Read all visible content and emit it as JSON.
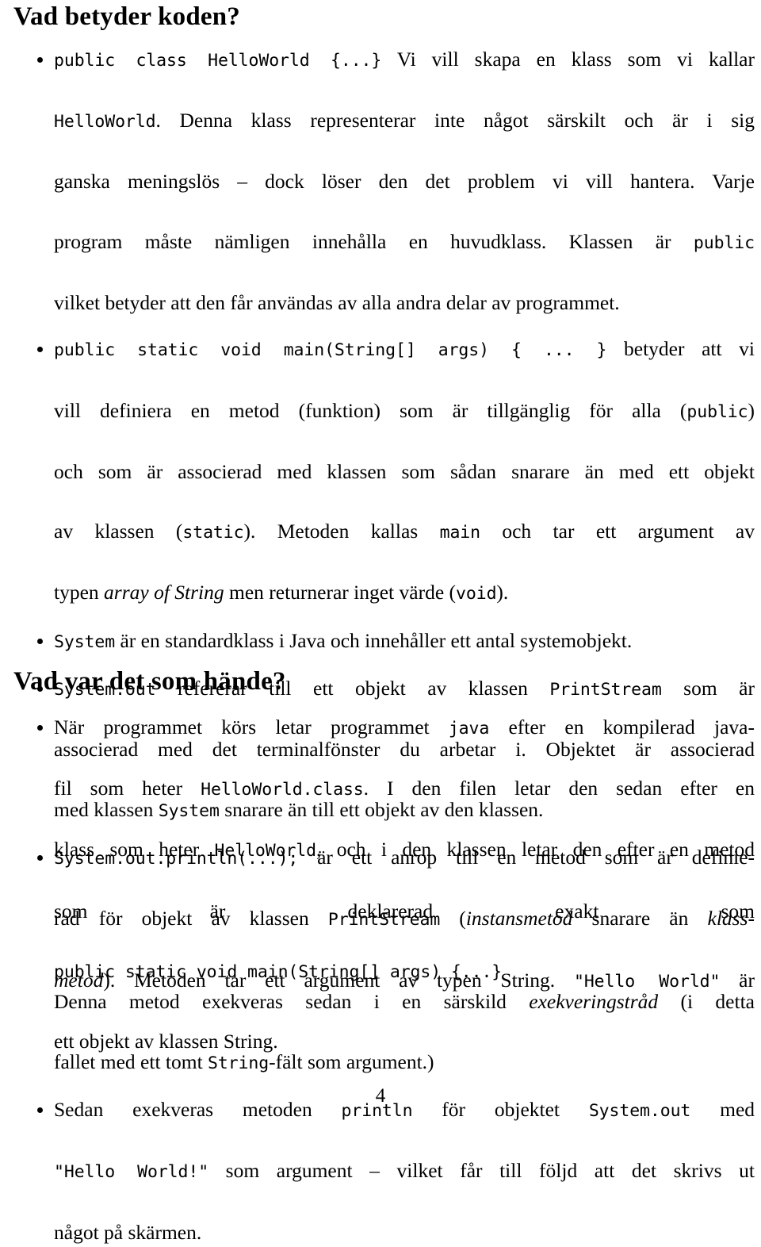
{
  "document": {
    "language": "sv",
    "page_number": "4",
    "background_color": "#ffffff",
    "text_color": "#000000"
  },
  "sections": [
    {
      "heading": "Vad betyder koden?",
      "bullets": [
        {
          "id": "bullet-public-class",
          "lines": [
            [
              {
                "t": "code",
                "v": "public class HelloWorld {...}"
              },
              {
                "t": "text",
                "v": " Vi vill skapa en klass som vi kallar"
              }
            ],
            [
              {
                "t": "code",
                "v": "HelloWorld"
              },
              {
                "t": "text",
                "v": ". Denna klass representerar inte något särskilt och är i sig"
              }
            ],
            [
              {
                "t": "text",
                "v": "ganska meningslös – dock löser den det problem vi vill hantera. Varje"
              }
            ],
            [
              {
                "t": "text",
                "v": "program måste nämligen innehålla en huvudklass. Klassen är "
              },
              {
                "t": "code",
                "v": "public"
              }
            ],
            [
              {
                "t": "text",
                "v": "vilket betyder att den får användas av alla andra delar av programmet."
              }
            ]
          ]
        },
        {
          "id": "bullet-main-method",
          "lines": [
            [
              {
                "t": "code",
                "v": "public static void main(String[] args) { ... }"
              },
              {
                "t": "text",
                "v": " betyder att vi"
              }
            ],
            [
              {
                "t": "text",
                "v": "vill definiera en metod (funktion) som är tillgänglig för alla ("
              },
              {
                "t": "code",
                "v": "public"
              },
              {
                "t": "text",
                "v": ")"
              }
            ],
            [
              {
                "t": "text",
                "v": "och som är associerad med klassen som sådan snarare än med ett objekt"
              }
            ],
            [
              {
                "t": "text",
                "v": "av klassen ("
              },
              {
                "t": "code",
                "v": "static"
              },
              {
                "t": "text",
                "v": "). Metoden kallas "
              },
              {
                "t": "code",
                "v": "main"
              },
              {
                "t": "text",
                "v": " och tar ett argument av"
              }
            ],
            [
              {
                "t": "text",
                "v": "typen "
              },
              {
                "t": "italic",
                "v": "array of String"
              },
              {
                "t": "text",
                "v": " men returnerar inget värde ("
              },
              {
                "t": "code",
                "v": "void"
              },
              {
                "t": "text",
                "v": ")."
              }
            ]
          ]
        },
        {
          "id": "bullet-system",
          "lines": [
            [
              {
                "t": "code",
                "v": "System"
              },
              {
                "t": "text",
                "v": " är en standardklass i Java och innehåller ett antal systemobjekt."
              }
            ]
          ]
        },
        {
          "id": "bullet-system-out",
          "lines": [
            [
              {
                "t": "code",
                "v": "System.out"
              },
              {
                "t": "text",
                "v": " refererar till ett objekt av klassen "
              },
              {
                "t": "code",
                "v": "PrintStream"
              },
              {
                "t": "text",
                "v": " som är"
              }
            ],
            [
              {
                "t": "text",
                "v": "associerad med det terminalfönster du arbetar i. Objektet är associerad"
              }
            ],
            [
              {
                "t": "text",
                "v": "med klassen "
              },
              {
                "t": "code",
                "v": "System"
              },
              {
                "t": "text",
                "v": " snarare än till ett objekt av den klassen."
              }
            ]
          ]
        },
        {
          "id": "bullet-println",
          "lines": [
            [
              {
                "t": "code",
                "v": "System.out.println(...);"
              },
              {
                "t": "text",
                "v": " är ett anrop till en metod som är definie-"
              }
            ],
            [
              {
                "t": "text",
                "v": "rad för objekt av klassen "
              },
              {
                "t": "code",
                "v": "PrintStream"
              },
              {
                "t": "text",
                "v": " ("
              },
              {
                "t": "italic",
                "v": "instansmetod"
              },
              {
                "t": "text",
                "v": " snarare än "
              },
              {
                "t": "italic",
                "v": "klass-"
              }
            ],
            [
              {
                "t": "italic",
                "v": "metod"
              },
              {
                "t": "text",
                "v": "). Metoden tar ett argument av typen String. "
              },
              {
                "t": "code",
                "v": "\"Hello World\""
              },
              {
                "t": "text",
                "v": " är"
              }
            ],
            [
              {
                "t": "text",
                "v": "ett objekt av klassen String."
              }
            ]
          ]
        }
      ]
    },
    {
      "heading": "Vad var det som hände?",
      "bullets": [
        {
          "id": "bullet-java-runtime",
          "lines": [
            [
              {
                "t": "text",
                "v": "När programmet körs letar programmet "
              },
              {
                "t": "code",
                "v": "java"
              },
              {
                "t": "text",
                "v": " efter en kompilerad java-"
              }
            ],
            [
              {
                "t": "text",
                "v": "fil som heter "
              },
              {
                "t": "code",
                "v": "HelloWorld.class"
              },
              {
                "t": "text",
                "v": ". I den filen letar den sedan efter en"
              }
            ],
            [
              {
                "t": "text",
                "v": "klass som heter "
              },
              {
                "t": "code",
                "v": "HelloWorld"
              },
              {
                "t": "text",
                "v": ", och i den klassen letar den efter en metod"
              }
            ],
            [
              {
                "t": "text",
                "v": "som är deklarerad exakt som"
              }
            ],
            [
              {
                "t": "code",
                "v": "public static void main(String[] args) {...}"
              }
            ],
            [
              {
                "t": "text",
                "v": "Denna metod exekveras sedan i en särskild "
              },
              {
                "t": "italic",
                "v": "exekveringstråd"
              },
              {
                "t": "text",
                "v": " (i detta"
              }
            ],
            [
              {
                "t": "text",
                "v": "fallet med ett tomt "
              },
              {
                "t": "code",
                "v": "String"
              },
              {
                "t": "text",
                "v": "-fält som argument.)"
              }
            ]
          ]
        },
        {
          "id": "bullet-println-exec",
          "lines": [
            [
              {
                "t": "text",
                "v": "Sedan exekveras metoden "
              },
              {
                "t": "code",
                "v": "println"
              },
              {
                "t": "text",
                "v": " för objektet "
              },
              {
                "t": "code",
                "v": "System.out"
              },
              {
                "t": "text",
                "v": " med"
              }
            ],
            [
              {
                "t": "code",
                "v": "\"Hello World!\""
              },
              {
                "t": "text",
                "v": " som argument – vilket får till följd att det skrivs ut"
              }
            ],
            [
              {
                "t": "text",
                "v": "något på skärmen."
              }
            ]
          ]
        }
      ]
    }
  ]
}
